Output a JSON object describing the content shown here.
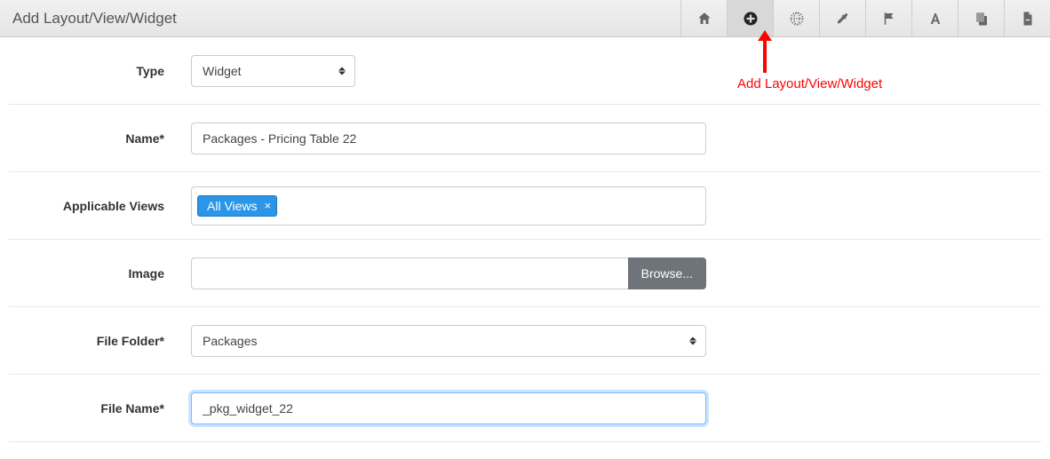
{
  "header": {
    "title": "Add Layout/View/Widget",
    "toolbar": [
      {
        "name": "home-icon"
      },
      {
        "name": "add-icon",
        "active": true
      },
      {
        "name": "globe-icon"
      },
      {
        "name": "eyedropper-icon"
      },
      {
        "name": "flag-icon"
      },
      {
        "name": "font-icon"
      },
      {
        "name": "copy-icon"
      },
      {
        "name": "file-icon"
      }
    ]
  },
  "fields": {
    "type": {
      "label": "Type",
      "value": "Widget"
    },
    "name": {
      "label": "Name*",
      "value": "Packages - Pricing Table 22"
    },
    "views": {
      "label": "Applicable Views",
      "tag": "All Views"
    },
    "image": {
      "label": "Image",
      "browse": "Browse..."
    },
    "folder": {
      "label": "File Folder*",
      "value": "Packages"
    },
    "file": {
      "label": "File Name*",
      "value": "_pkg_widget_22"
    }
  },
  "annotation": {
    "text": "Add Layout/View/Widget"
  }
}
